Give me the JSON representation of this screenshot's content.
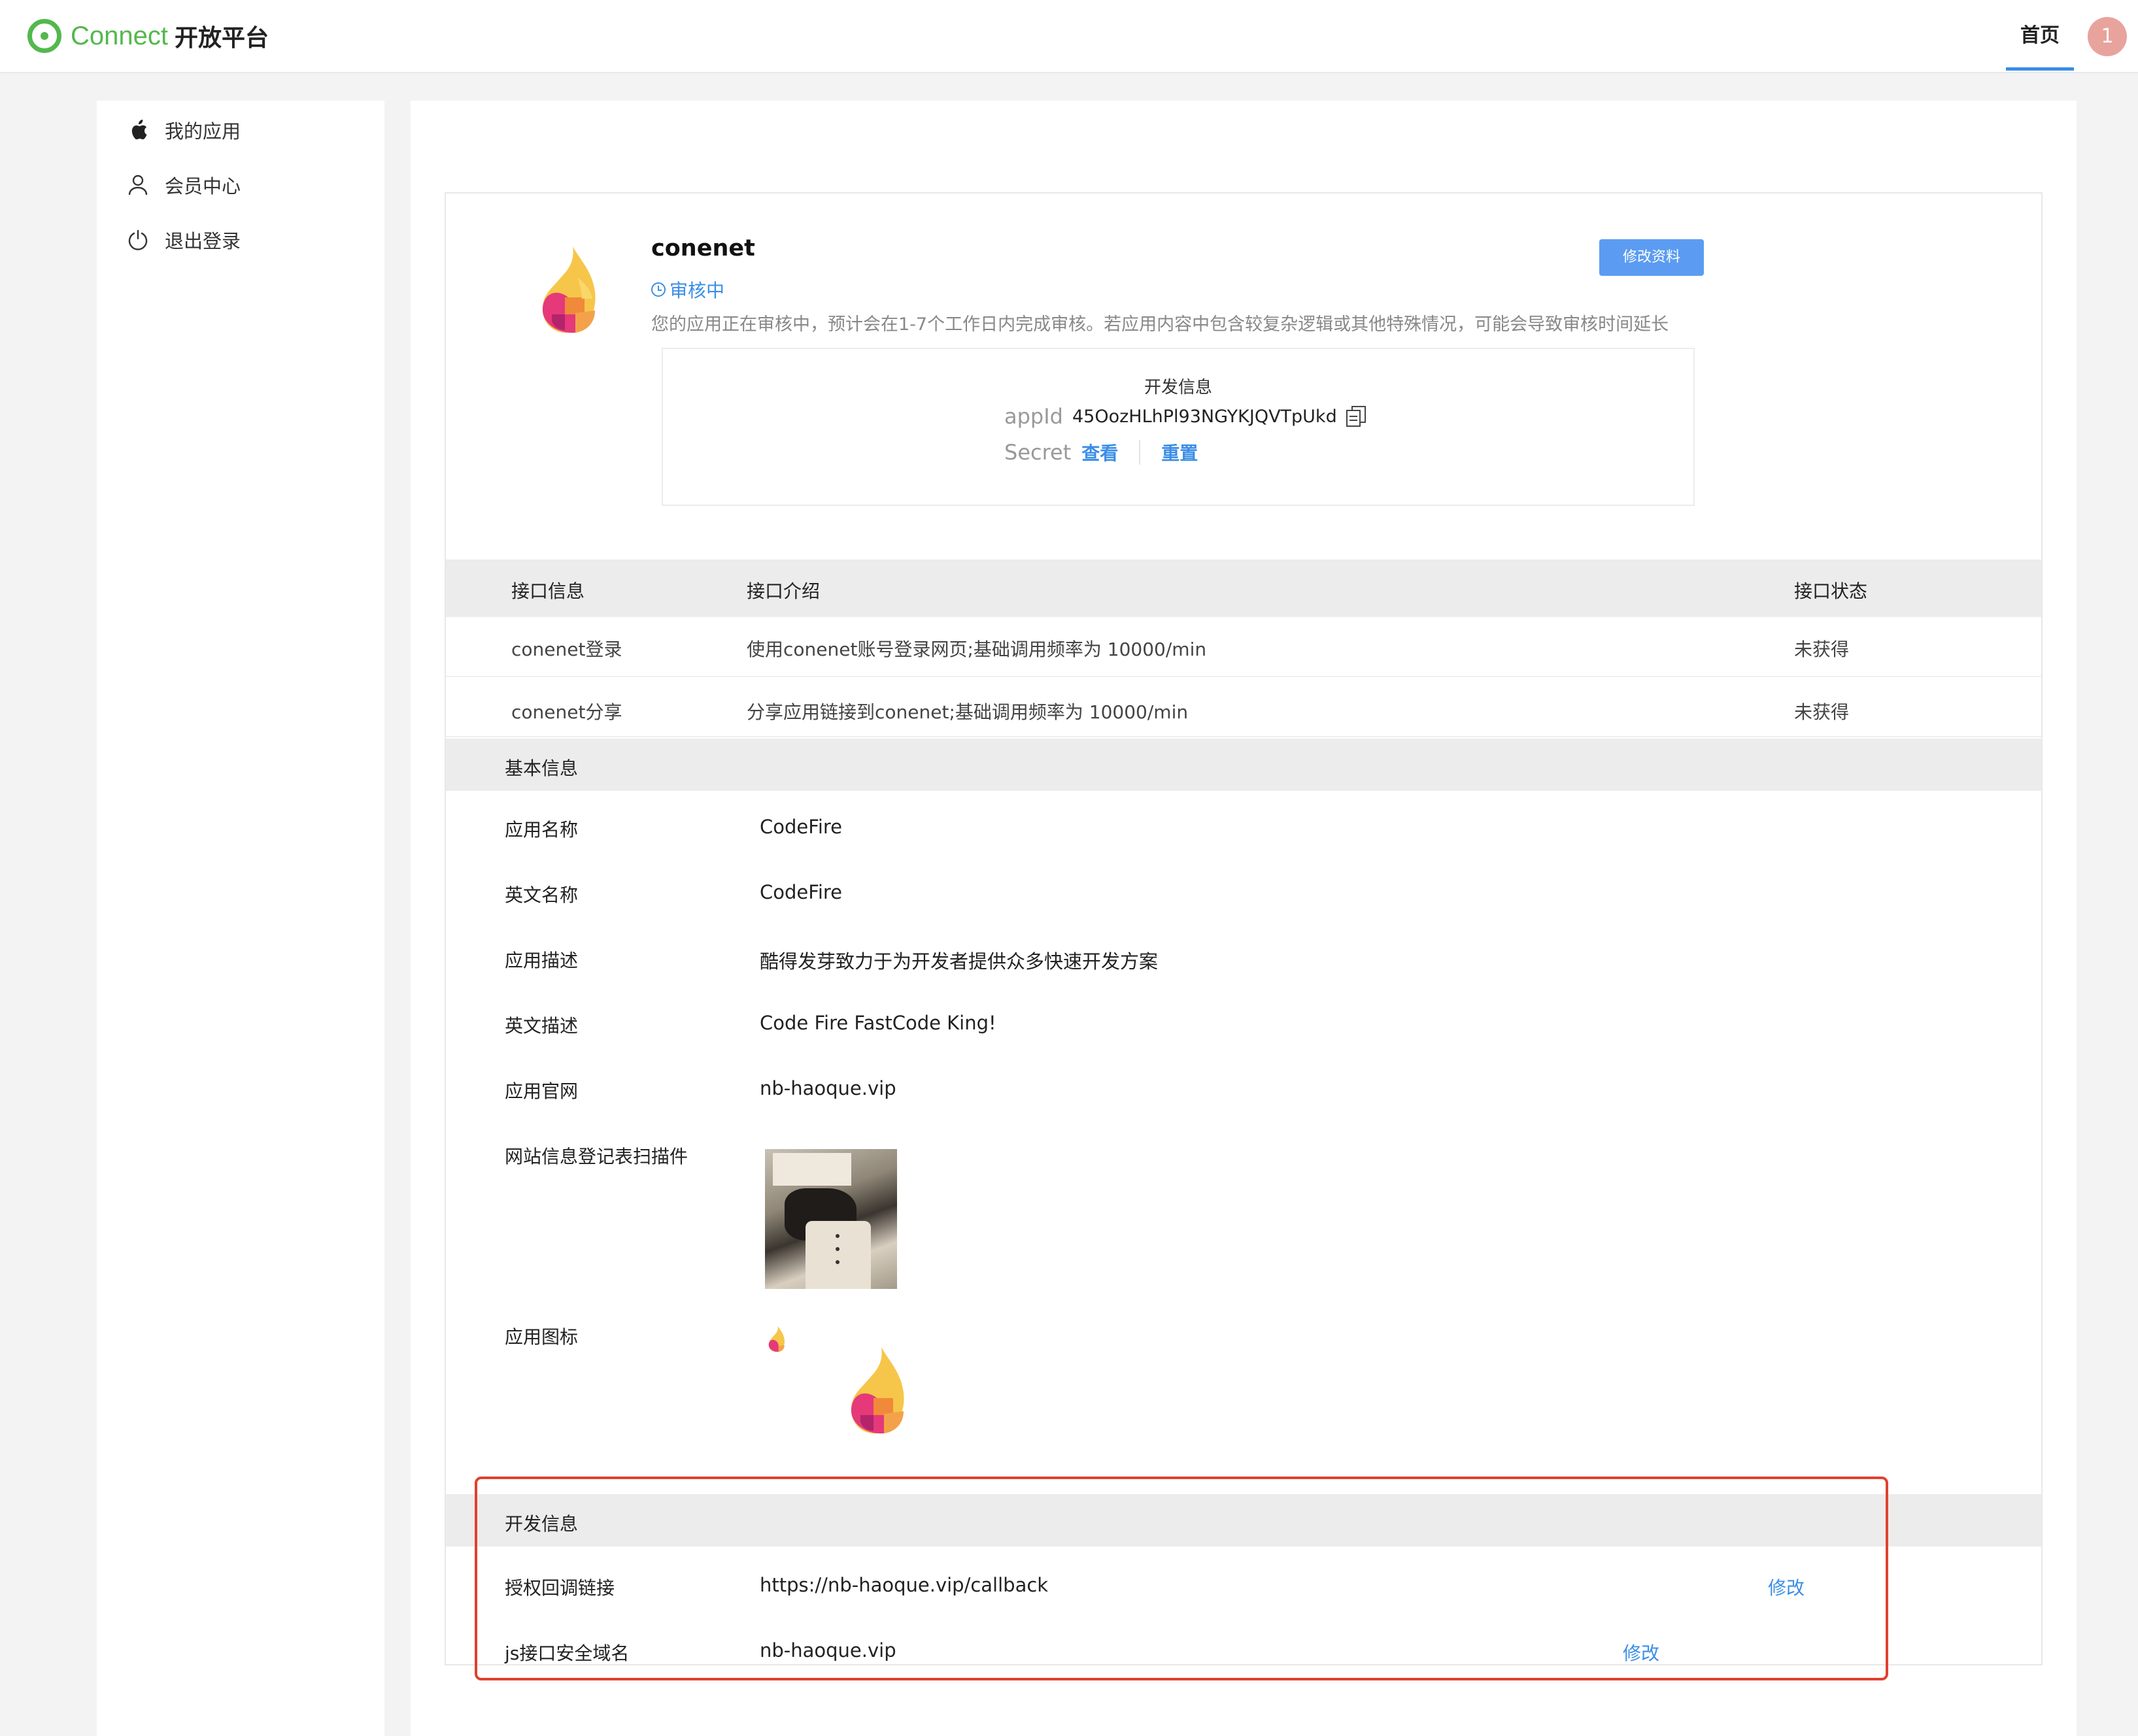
{
  "header": {
    "brand": "Connect",
    "brand_sub": "开放平台",
    "nav_home": "首页",
    "avatar_text": "1",
    "accent": "#3a8ee6",
    "brand_color": "#53b84d"
  },
  "sidebar": {
    "items": [
      {
        "label": "我的应用",
        "icon": "apple-icon"
      },
      {
        "label": "会员中心",
        "icon": "user-icon"
      },
      {
        "label": "退出登录",
        "icon": "power-icon"
      }
    ]
  },
  "app": {
    "name": "conenet",
    "status": "审核中",
    "notice": "您的应用正在审核中，预计会在1-7个工作日内完成审核。若应用内容中包含较复杂逻辑或其他特殊情况，可能会导致审核时间延长",
    "edit_button": "修改资料",
    "dev_info": {
      "title": "开发信息",
      "appid_label": "appId",
      "appid_value": "45OozHLhPl93NGYKJQVTpUkd",
      "secret_label": "Secret",
      "view_link": "查看",
      "reset_link": "重置"
    }
  },
  "api_table": {
    "headers": [
      "接口信息",
      "接口介绍",
      "接口状态"
    ],
    "rows": [
      {
        "name": "conenet登录",
        "desc": "使用conenet账号登录网页;基础调用频率为 10000/min",
        "status": "未获得"
      },
      {
        "name": "conenet分享",
        "desc": "分享应用链接到conenet;基础调用频率为 10000/min",
        "status": "未获得"
      }
    ]
  },
  "basic_info": {
    "title": "基本信息",
    "rows": [
      {
        "label": "应用名称",
        "value": "CodeFire"
      },
      {
        "label": "英文名称",
        "value": "CodeFire"
      },
      {
        "label": "应用描述",
        "value": "酷得发芽致力于为开发者提供众多快速开发方案"
      },
      {
        "label": "英文描述",
        "value": "Code Fire FastCode King!"
      },
      {
        "label": "应用官网",
        "value": "nb-haoque.vip"
      },
      {
        "label": "网站信息登记表扫描件",
        "value": ""
      },
      {
        "label": "应用图标",
        "value": ""
      }
    ]
  },
  "dev_section": {
    "title": "开发信息",
    "rows": [
      {
        "label": "授权回调链接",
        "value": "https://nb-haoque.vip/callback",
        "edit": "修改"
      },
      {
        "label": "js接口安全域名",
        "value": "nb-haoque.vip",
        "edit": "修改"
      }
    ]
  }
}
